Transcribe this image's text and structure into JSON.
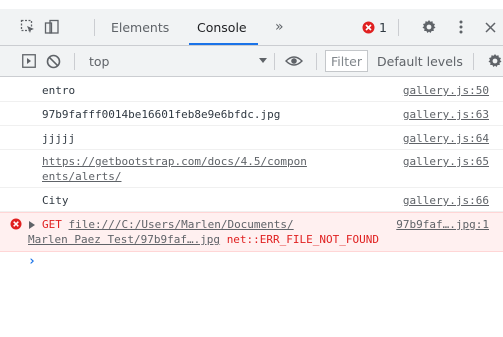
{
  "tabs": {
    "elements_label": "Elements",
    "console_label": "Console",
    "more_label": "»",
    "error_count": "1"
  },
  "toolbar": {
    "context": "top",
    "filter_placeholder": "Filter",
    "levels_label": "Default levels"
  },
  "messages": [
    {
      "text": "entro",
      "source": "gallery.js:50"
    },
    {
      "text": "97b9fafff0014be16601feb8e9e6bfdc.jpg",
      "source": "gallery.js:63"
    },
    {
      "text": "jjjjj",
      "source": "gallery.js:64"
    },
    {
      "text_line1": "https://getbootstrap.com/docs/4.5/compon",
      "text_line2": "ents/alerts/",
      "source": "gallery.js:65"
    },
    {
      "text": "City",
      "source": "gallery.js:66"
    }
  ],
  "error": {
    "method": "GET",
    "url_line1": "file:///C:/Users/Marlen/Documents/",
    "url_line2": "Marlen Paez Test/97b9faf….jpg",
    "source": "97b9faf….jpg:1",
    "code": "net::ERR_FILE_NOT_FOUND"
  },
  "colors": {
    "accent": "#1a73e8",
    "error": "#e02020",
    "error_bg": "#fff0f0"
  }
}
